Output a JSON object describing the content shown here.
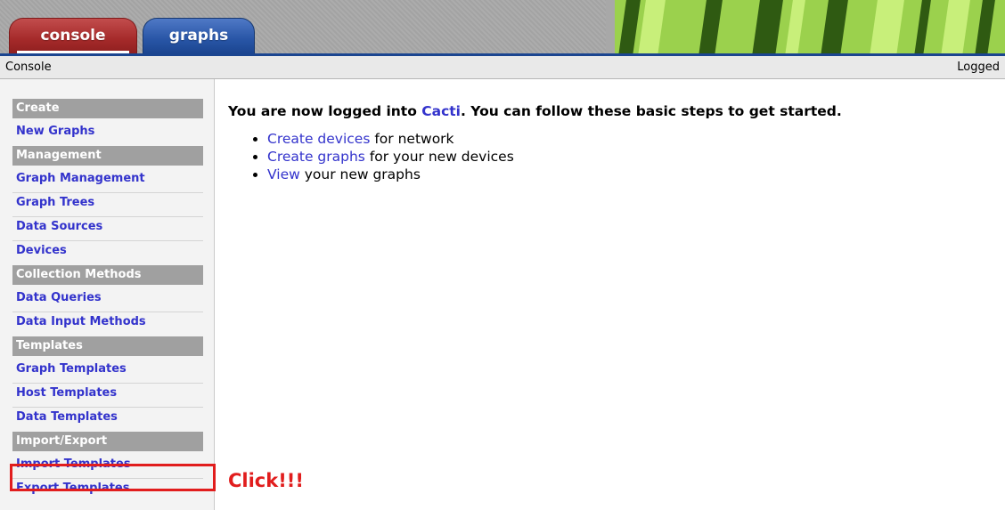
{
  "tabs": [
    {
      "label": "console",
      "active": true,
      "color": "#a52a2a"
    },
    {
      "label": "graphs",
      "active": false,
      "color": "#2855a6"
    }
  ],
  "breadcrumb": "Console",
  "status": "Logged",
  "sidebar": {
    "sections": [
      {
        "header": "Create",
        "items": [
          {
            "label": "New Graphs"
          }
        ]
      },
      {
        "header": "Management",
        "items": [
          {
            "label": "Graph Management"
          },
          {
            "label": "Graph Trees"
          },
          {
            "label": "Data Sources"
          },
          {
            "label": "Devices"
          }
        ]
      },
      {
        "header": "Collection Methods",
        "items": [
          {
            "label": "Data Queries"
          },
          {
            "label": "Data Input Methods"
          }
        ]
      },
      {
        "header": "Templates",
        "items": [
          {
            "label": "Graph Templates"
          },
          {
            "label": "Host Templates"
          },
          {
            "label": "Data Templates"
          }
        ]
      },
      {
        "header": "Import/Export",
        "items": [
          {
            "label": "Import Templates"
          },
          {
            "label": "Export Templates"
          }
        ]
      }
    ]
  },
  "main": {
    "intro_before": "You are now logged into ",
    "intro_link": "Cacti",
    "intro_after": ". You can follow these basic steps to get started.",
    "steps": [
      {
        "link": "Create devices",
        "rest": " for network"
      },
      {
        "link": "Create graphs",
        "rest": " for your new devices"
      },
      {
        "link": "View",
        "rest": " your new graphs"
      }
    ]
  },
  "annotation": {
    "text": "Click!!!",
    "color": "#e11d1d"
  },
  "colors": {
    "link": "#3333cc",
    "menu_header": "#a0a0a0",
    "accent": "#1b4590"
  }
}
